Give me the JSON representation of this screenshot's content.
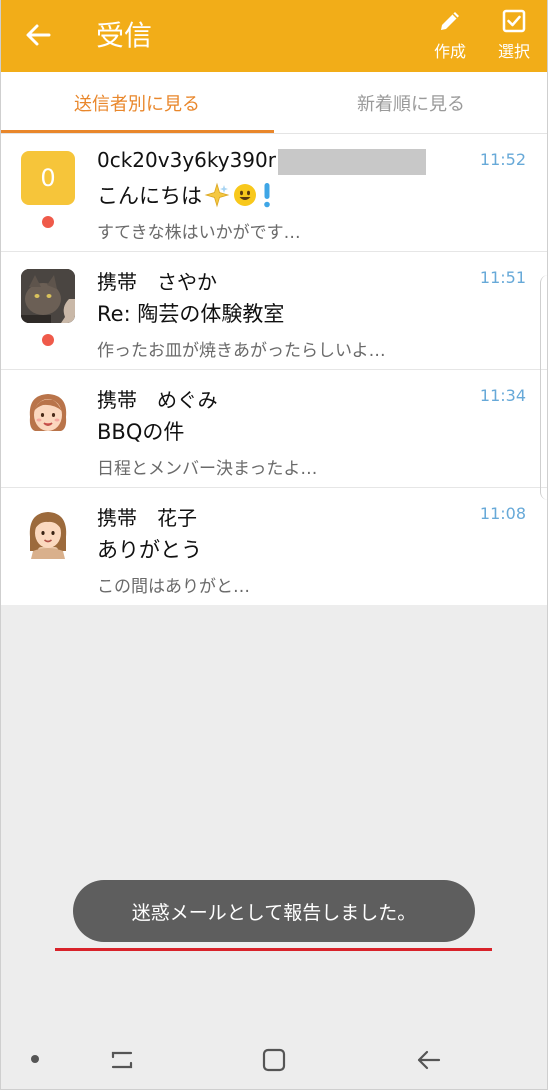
{
  "header": {
    "title": "受信",
    "back_icon": "arrow-left-icon",
    "actions": [
      {
        "label": "作成",
        "icon": "pencil-icon"
      },
      {
        "label": "選択",
        "icon": "checkbox-icon"
      }
    ],
    "color": "#f2ad18"
  },
  "tabs": {
    "active_label": "送信者別に見る",
    "inactive_label": "新着順に見る",
    "accent_color": "#e9872b"
  },
  "messages": [
    {
      "avatar_text": "0",
      "sender": "0ck20v3y6ky390r",
      "subject": "こんにちは",
      "preview": "すてきな株はいかがです…",
      "time": "11:52",
      "unread": true
    },
    {
      "avatar_icon": "cat-photo-avatar",
      "sender": "携帯　さやか",
      "subject": "Re: 陶芸の体験教室",
      "preview": "作ったお皿が焼きあがったらしいよ…",
      "time": "11:51",
      "unread": true
    },
    {
      "avatar_icon": "woman-face-avatar",
      "sender": "携帯　めぐみ",
      "subject": "BBQの件",
      "preview": "日程とメンバー決まったよ…",
      "time": "11:34",
      "unread": false
    },
    {
      "avatar_icon": "girl-face-avatar",
      "sender": "携帯　花子",
      "subject": "ありがとう",
      "preview": "この間はありがと…",
      "time": "11:08",
      "unread": false
    }
  ],
  "toast": {
    "text": "迷惑メールとして報告しました。"
  },
  "colors": {
    "unread_dot": "#ef5a4a",
    "time": "#67a9d8",
    "highlight_line": "#d8222a"
  }
}
